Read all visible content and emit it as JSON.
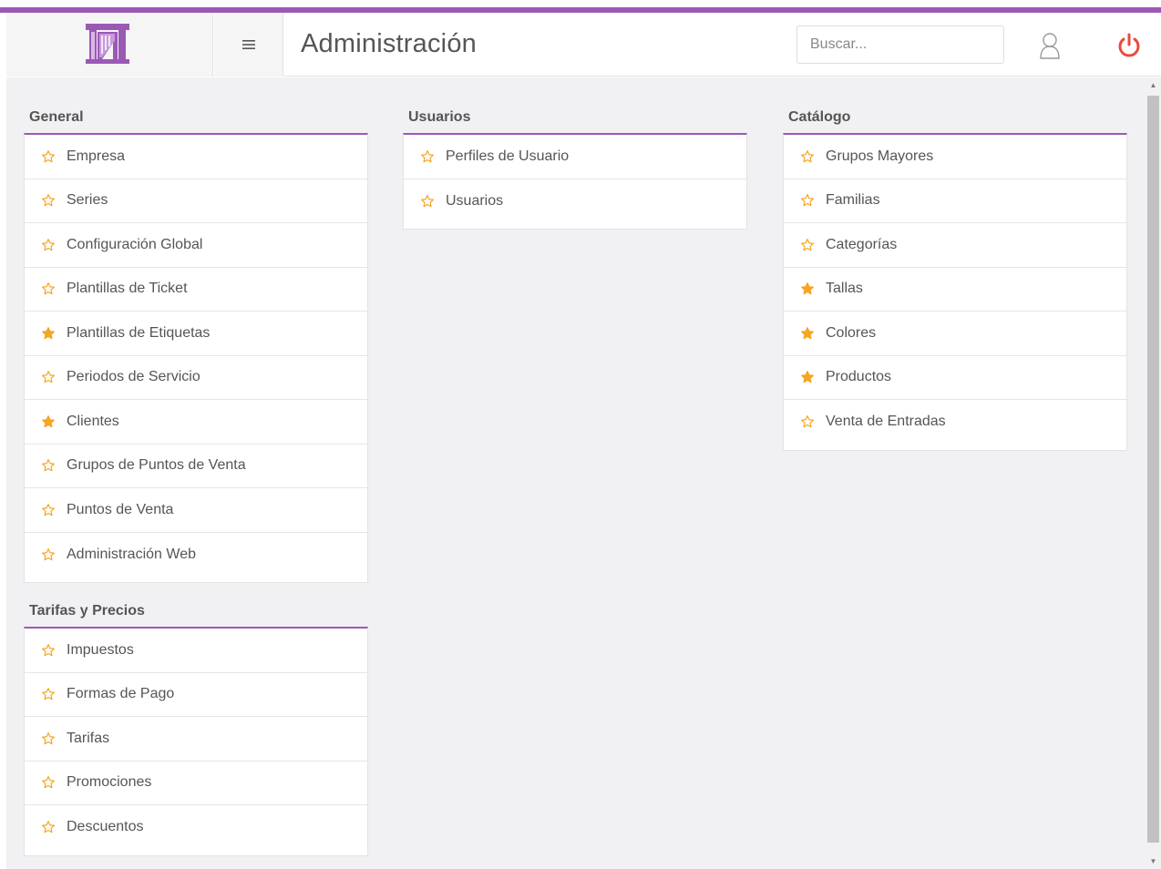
{
  "header": {
    "title": "Administración",
    "search_placeholder": "Buscar...",
    "menu_icon": "hamburger-icon",
    "user_icon": "user-icon",
    "power_icon": "power-icon",
    "logo_icon": "gate-logo-icon"
  },
  "colors": {
    "accent": "#9b59b6",
    "star": "#f5a623",
    "power": "#e74c3c"
  },
  "sections": {
    "general": {
      "title": "General",
      "items": [
        {
          "label": "Empresa",
          "favorite": false
        },
        {
          "label": "Series",
          "favorite": false
        },
        {
          "label": "Configuración Global",
          "favorite": false
        },
        {
          "label": "Plantillas de Ticket",
          "favorite": false
        },
        {
          "label": "Plantillas de Etiquetas",
          "favorite": true
        },
        {
          "label": "Periodos de Servicio",
          "favorite": false
        },
        {
          "label": "Clientes",
          "favorite": true
        },
        {
          "label": "Grupos de Puntos de Venta",
          "favorite": false
        },
        {
          "label": "Puntos de Venta",
          "favorite": false
        },
        {
          "label": "Administración Web",
          "favorite": false
        }
      ]
    },
    "tarifas": {
      "title": "Tarifas y Precios",
      "items": [
        {
          "label": "Impuestos",
          "favorite": false
        },
        {
          "label": "Formas de Pago",
          "favorite": false
        },
        {
          "label": "Tarifas",
          "favorite": false
        },
        {
          "label": "Promociones",
          "favorite": false
        },
        {
          "label": "Descuentos",
          "favorite": false
        }
      ]
    },
    "usuarios": {
      "title": "Usuarios",
      "items": [
        {
          "label": "Perfiles de Usuario",
          "favorite": false
        },
        {
          "label": "Usuarios",
          "favorite": false
        }
      ]
    },
    "catalogo": {
      "title": "Catálogo",
      "items": [
        {
          "label": "Grupos Mayores",
          "favorite": false
        },
        {
          "label": "Familias",
          "favorite": false
        },
        {
          "label": "Categorías",
          "favorite": false
        },
        {
          "label": "Tallas",
          "favorite": true
        },
        {
          "label": "Colores",
          "favorite": true
        },
        {
          "label": "Productos",
          "favorite": true
        },
        {
          "label": "Venta de Entradas",
          "favorite": false
        }
      ]
    }
  }
}
